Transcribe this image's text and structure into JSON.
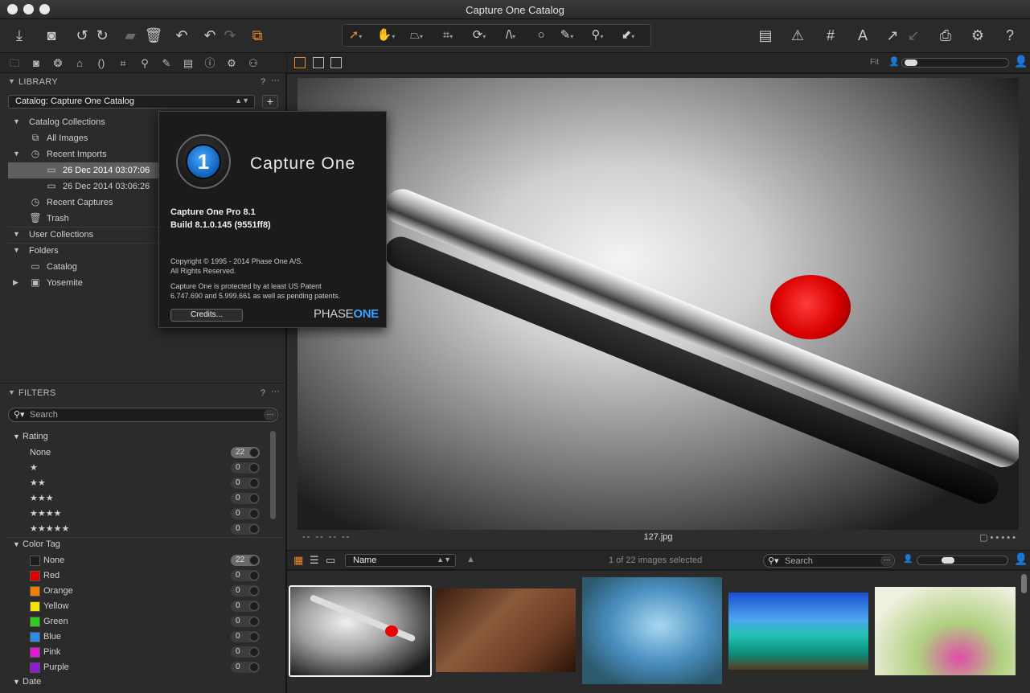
{
  "window": {
    "title": "Capture One Catalog"
  },
  "toolbar": {
    "left_icons": [
      "import-icon",
      "capture-icon",
      "rotate-left-icon",
      "rotate-right-icon",
      "move-to-icon",
      "trash-icon",
      "undo-icon",
      "redo-back-icon",
      "redo-icon",
      "variants-icon"
    ],
    "cursor_tools": [
      "select-icon",
      "pan-icon",
      "keystone-icon",
      "crop-icon",
      "rotate-icon",
      "perspective-icon",
      "circle-icon",
      "brush-icon",
      "picker-icon",
      "eraser-icon"
    ],
    "right_icons": [
      "compare-icon",
      "exposure-warning-icon",
      "grid-icon",
      "text-icon",
      "copy-adjustments-icon",
      "apply-adjustments-icon",
      "print-icon",
      "settings-icon",
      "help-icon"
    ],
    "accent": "#e8892b"
  },
  "tool_tabs": [
    "library-tab-icon",
    "capture-tab-icon",
    "color-tab-icon",
    "exposure-tab-icon",
    "lens-tab-icon",
    "composition-tab-icon",
    "details-tab-icon",
    "adjustments-tab-icon",
    "metadata-tab-icon",
    "output-tab-icon",
    "settings-tab-icon",
    "batch-tab-icon"
  ],
  "library": {
    "title": "LIBRARY",
    "help": "?",
    "more": "···",
    "catalog_select": "Catalog: Capture One Catalog",
    "add_label": "+",
    "tree": {
      "catalog_collections": "Catalog Collections",
      "all_images": "All Images",
      "recent_imports": "Recent Imports",
      "import_1": "26 Dec 2014 03:07:06",
      "import_2": "26 Dec 2014 03:06:26",
      "recent_captures": "Recent Captures",
      "trash": "Trash",
      "user_collections": "User Collections",
      "folders": "Folders",
      "catalog": "Catalog",
      "yosemite": "Yosemite"
    }
  },
  "filters": {
    "title": "FILTERS",
    "help": "?",
    "more": "···",
    "search_placeholder": "Search",
    "rating_label": "Rating",
    "rating": [
      {
        "label": "None",
        "count": "22"
      },
      {
        "label": "★",
        "count": "0"
      },
      {
        "label": "★★",
        "count": "0"
      },
      {
        "label": "★★★",
        "count": "0"
      },
      {
        "label": "★★★★",
        "count": "0"
      },
      {
        "label": "★★★★★",
        "count": "0"
      }
    ],
    "color_tag_label": "Color Tag",
    "color_tags": [
      {
        "label": "None",
        "count": "22",
        "color": "#1e1e1e"
      },
      {
        "label": "Red",
        "count": "0",
        "color": "#e00000"
      },
      {
        "label": "Orange",
        "count": "0",
        "color": "#f07f00"
      },
      {
        "label": "Yellow",
        "count": "0",
        "color": "#f5e400"
      },
      {
        "label": "Green",
        "count": "0",
        "color": "#2dcc1d"
      },
      {
        "label": "Blue",
        "count": "0",
        "color": "#2a8ee8"
      },
      {
        "label": "Pink",
        "count": "0",
        "color": "#e21ad6"
      },
      {
        "label": "Purple",
        "count": "0",
        "color": "#8e1ad9"
      }
    ],
    "date_label": "Date"
  },
  "viewer": {
    "zoom_label": "Fit",
    "filename": "127.jpg",
    "dashes": "-- -- -- --",
    "status_right": "▢ • • • • •"
  },
  "browser": {
    "sort_label": "Name",
    "selection_status": "1 of 22 images selected",
    "search_placeholder": "Search"
  },
  "about": {
    "product": "Capture One",
    "version": "Capture One Pro 8.1",
    "build": "Build 8.1.0.145 (9551ff8)",
    "copyright": "Copyright © 1995 - 2014 Phase One A/S.",
    "rights": "All Rights Reserved.",
    "patent_1": "Capture One is protected by at least US Patent",
    "patent_2": "6.747.690 and 5.999.661 as well as pending patents.",
    "credits_label": "Credits...",
    "brand_phase": "PHASE",
    "brand_one": "ONE",
    "logo_glyph": "1"
  }
}
